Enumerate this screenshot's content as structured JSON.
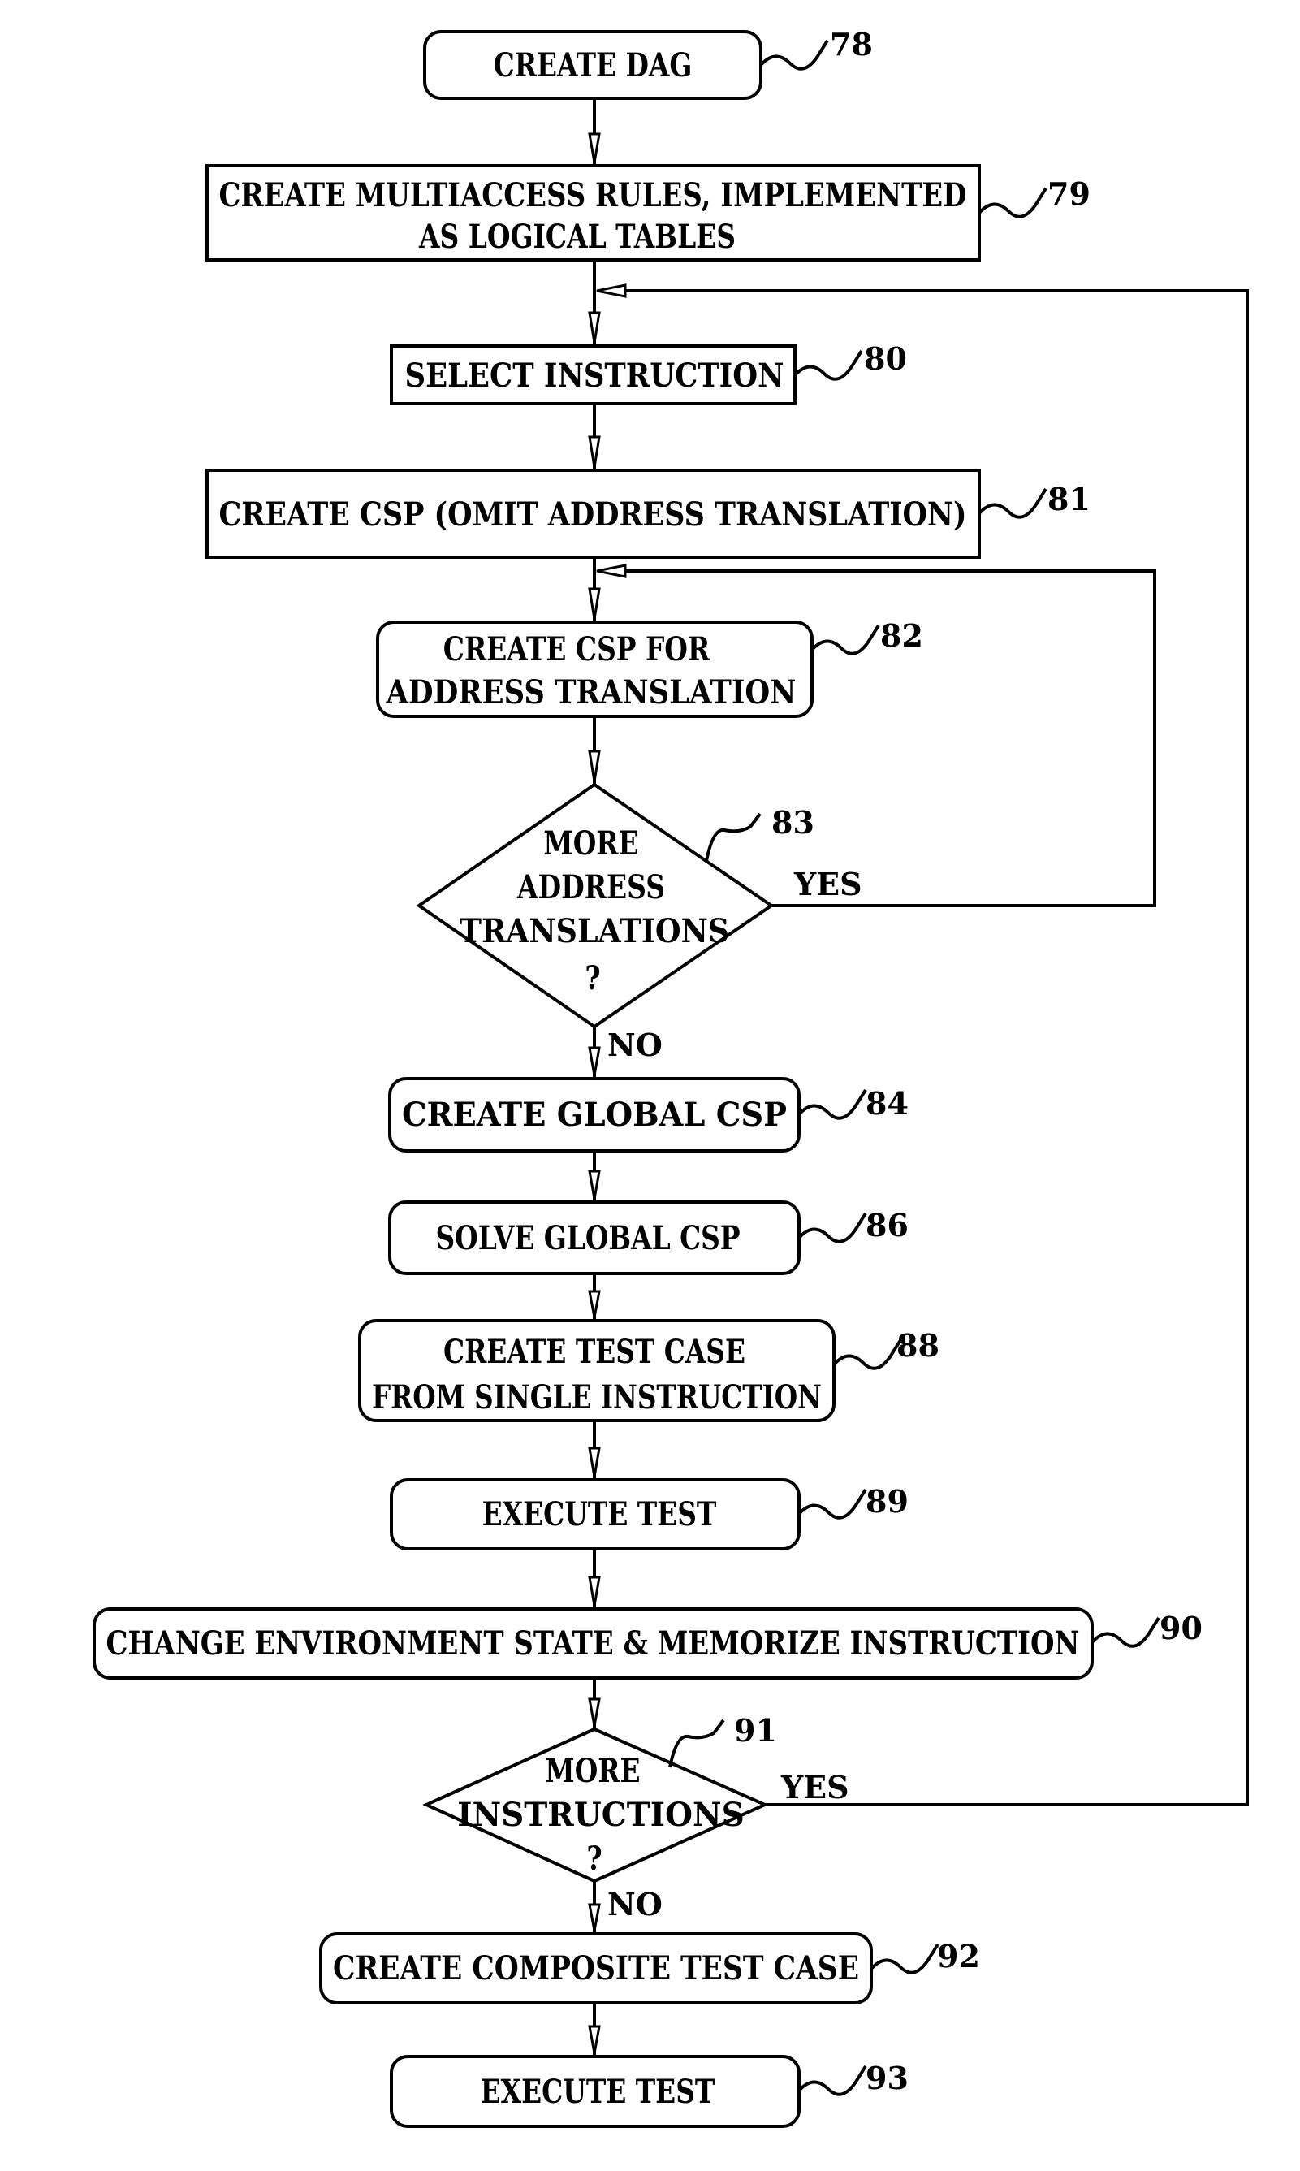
{
  "diagram": {
    "type": "flowchart",
    "steps": [
      {
        "ref": "78",
        "lines": [
          "CREATE DAG"
        ],
        "shape": "rounded"
      },
      {
        "ref": "79",
        "lines": [
          "CREATE MULTIACCESS RULES, IMPLEMENTED",
          "AS LOGICAL TABLES"
        ],
        "shape": "rect"
      },
      {
        "ref": "80",
        "lines": [
          "SELECT INSTRUCTION"
        ],
        "shape": "rect"
      },
      {
        "ref": "81",
        "lines": [
          "CREATE CSP (OMIT ADDRESS TRANSLATION)"
        ],
        "shape": "rect"
      },
      {
        "ref": "82",
        "lines": [
          "CREATE CSP FOR",
          "ADDRESS TRANSLATION"
        ],
        "shape": "rounded"
      },
      {
        "ref": "83",
        "lines": [
          "MORE",
          "ADDRESS",
          "TRANSLATIONS",
          "?"
        ],
        "shape": "diamond"
      },
      {
        "ref": "84",
        "lines": [
          "CREATE GLOBAL CSP"
        ],
        "shape": "rounded"
      },
      {
        "ref": "86",
        "lines": [
          "SOLVE GLOBAL CSP"
        ],
        "shape": "rounded"
      },
      {
        "ref": "88",
        "lines": [
          "CREATE TEST CASE",
          "FROM SINGLE INSTRUCTION"
        ],
        "shape": "rounded"
      },
      {
        "ref": "89",
        "lines": [
          "EXECUTE TEST"
        ],
        "shape": "rounded"
      },
      {
        "ref": "90",
        "lines": [
          "CHANGE ENVIRONMENT STATE & MEMORIZE INSTRUCTION"
        ],
        "shape": "rounded"
      },
      {
        "ref": "91",
        "lines": [
          "MORE",
          "INSTRUCTIONS",
          "?"
        ],
        "shape": "diamond"
      },
      {
        "ref": "92",
        "lines": [
          "CREATE COMPOSITE TEST CASE"
        ],
        "shape": "rounded"
      },
      {
        "ref": "93",
        "lines": [
          "EXECUTE TEST"
        ],
        "shape": "rounded"
      }
    ],
    "branches": {
      "d83_yes": "YES",
      "d83_no": "NO",
      "d91_yes": "YES",
      "d91_no": "NO"
    }
  }
}
